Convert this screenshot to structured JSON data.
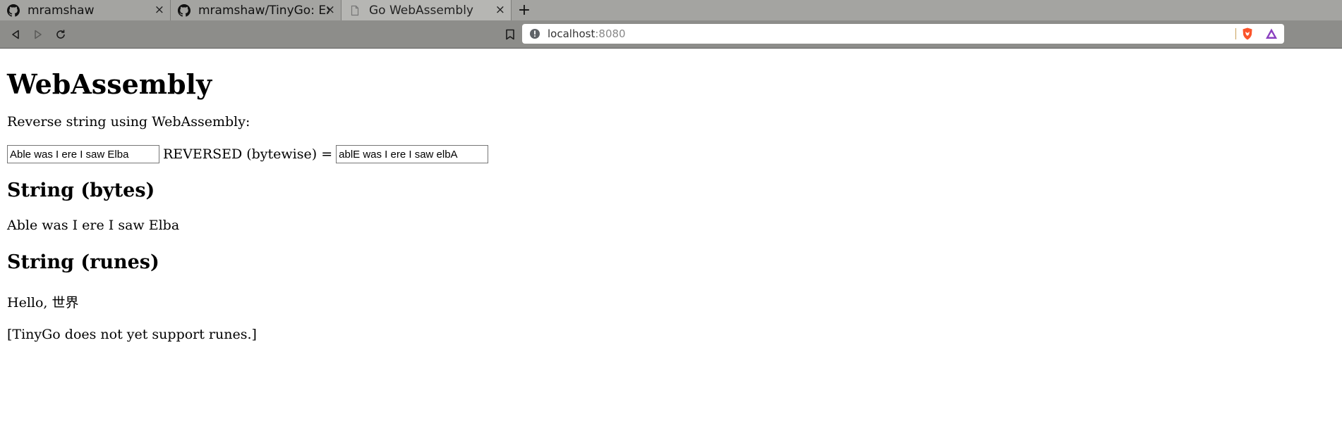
{
  "browser": {
    "tabs": [
      {
        "title": "mramshaw",
        "icon": "github-icon",
        "active": false
      },
      {
        "title": "mramshaw/TinyGo: Exp",
        "icon": "github-icon",
        "active": false
      },
      {
        "title": "Go WebAssembly",
        "icon": "page-icon",
        "active": true
      }
    ],
    "close_glyph": "×",
    "new_tab_glyph": "+",
    "address": {
      "host": "localhost",
      "port": ":8080"
    }
  },
  "page": {
    "title": "WebAssembly",
    "intro": "Reverse string using WebAssembly:",
    "input_value": "Able was I ere I saw Elba",
    "reversed_label": "REVERSED (bytewise) =",
    "output_value": "ablE was I ere I saw elbA",
    "bytes_heading": "String (bytes)",
    "bytes_text": "Able was I ere I saw Elba",
    "runes_heading": "String (runes)",
    "runes_text": "Hello, 世界",
    "runes_note": "[TinyGo does not yet support runes.]"
  }
}
